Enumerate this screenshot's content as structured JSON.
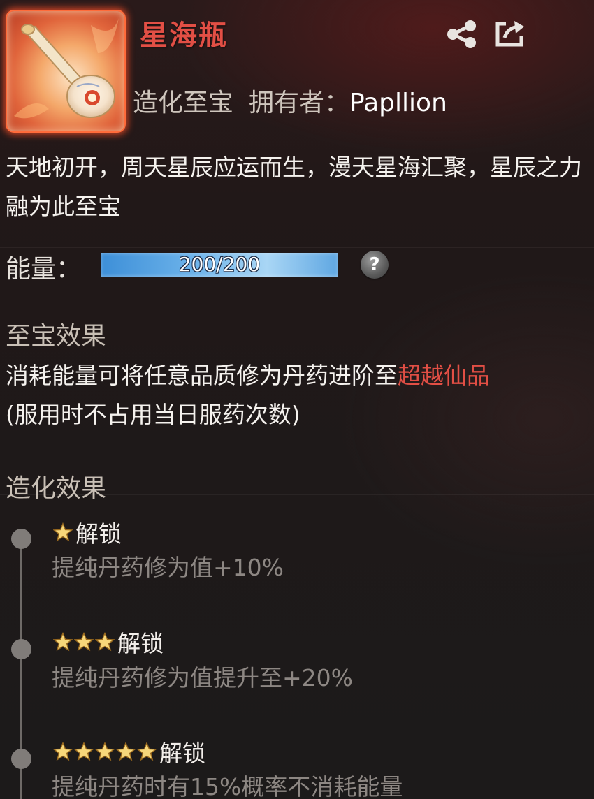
{
  "item": {
    "name": "星海瓶",
    "grade": "造化至宝",
    "owner_label": "拥有者：",
    "owner_name": "Papllion",
    "icon": "star-sea-bottle-icon"
  },
  "toolbar": {
    "share_icon": "share-icon",
    "export_icon": "export-icon"
  },
  "description": "天地初开，周天星辰应运而生，漫天星海汇聚，星辰之力融为此至宝",
  "energy": {
    "label": "能量：",
    "current": 200,
    "max": 200,
    "text": "200/200",
    "fill_fraction": 1.0,
    "help_symbol": "?"
  },
  "treasure_effect": {
    "title": "至宝效果",
    "text_before": "消耗能量可将任意品质修为丹药进阶至",
    "highlight": "超越仙品",
    "text_after": "(服用时不占用当日服药次数)"
  },
  "creation_effect": {
    "title": "造化效果",
    "unlocks": [
      {
        "stars": 1,
        "label": "解锁",
        "desc": "提纯丹药修为值+10%"
      },
      {
        "stars": 3,
        "label": "解锁",
        "desc": "提纯丹药修为值提升至+20%"
      },
      {
        "stars": 5,
        "label": "解锁",
        "desc": "提纯丹药时有15%概率不消耗能量"
      }
    ]
  },
  "colors": {
    "title_red": "#e24f45",
    "highlight_red": "#e24f45",
    "energy_blue": "#6db3ea",
    "star_gold": "#f7d77a",
    "muted_text": "#8d8783"
  }
}
